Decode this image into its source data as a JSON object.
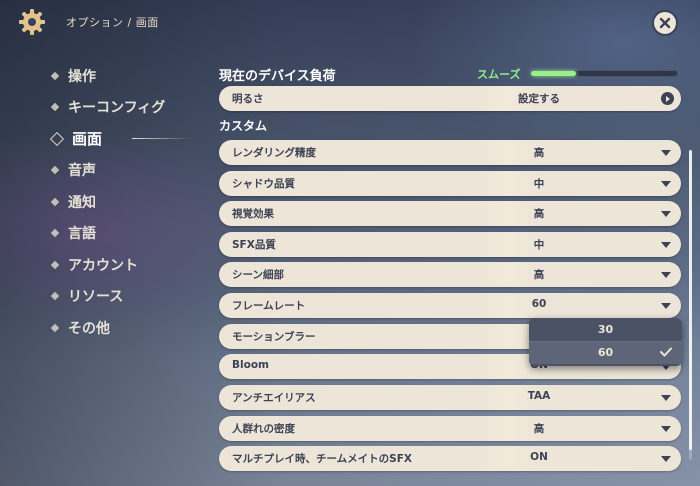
{
  "header": {
    "breadcrumb": "オプション / 画面"
  },
  "sidebar": {
    "items": [
      {
        "label": "操作"
      },
      {
        "label": "キーコンフィグ"
      },
      {
        "label": "画面"
      },
      {
        "label": "音声"
      },
      {
        "label": "通知"
      },
      {
        "label": "言語"
      },
      {
        "label": "アカウント"
      },
      {
        "label": "リソース"
      },
      {
        "label": "その他"
      }
    ],
    "active": "画面"
  },
  "performance": {
    "title": "現在のデバイス負荷",
    "status": "スムーズ",
    "level": 0.31,
    "color": "#8ff08a"
  },
  "brightness": {
    "label": "明るさ",
    "value": "設定する"
  },
  "custom": {
    "title": "カスタム",
    "rows": [
      {
        "label": "レンダリング精度",
        "value": "高"
      },
      {
        "label": "シャドウ品質",
        "value": "中"
      },
      {
        "label": "視覚効果",
        "value": "高"
      },
      {
        "label": "SFX品質",
        "value": "中"
      },
      {
        "label": "シーン細部",
        "value": "高"
      },
      {
        "label": "フレームレート",
        "value": "60"
      },
      {
        "label": "モーションブラー",
        "value": ""
      },
      {
        "label": "Bloom",
        "value": "ON"
      },
      {
        "label": "アンチエイリアス",
        "value": "TAA"
      },
      {
        "label": "人群れの密度",
        "value": "高"
      },
      {
        "label": "マルチプレイ時、チームメイトのSFX",
        "value": "ON"
      }
    ]
  },
  "dropdown": {
    "options": [
      "30",
      "60"
    ],
    "selected": "60"
  },
  "colors": {
    "row_bg": "#ece5d8",
    "text_dark": "#3d4255",
    "dropdown_bg": "#4b5266"
  }
}
